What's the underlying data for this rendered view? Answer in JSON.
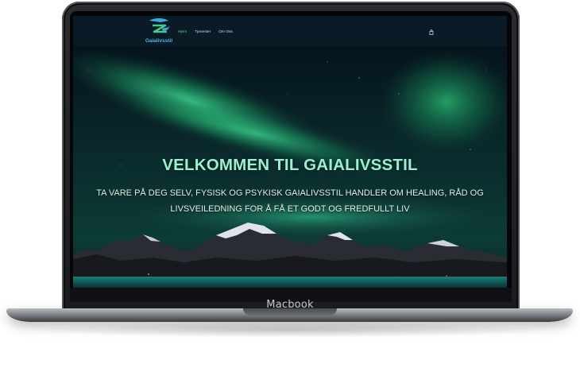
{
  "device": {
    "label": "Macbook"
  },
  "site": {
    "logo_text": "Gaialivsstil",
    "nav": [
      {
        "label": "Hjem",
        "active": true
      },
      {
        "label": "Tjenester",
        "active": false
      },
      {
        "label": "Om Oss",
        "active": false
      }
    ],
    "cart_icon": "shopping-bag-icon",
    "hero": {
      "title": "VELKOMMEN TIL GAIALIVSSTIL",
      "subtitle": "TA VARE PÅ DEG SELV, FYSISK OG PSYKISK GAIALIVSSTIL HANDLER OM HEALING, RÅD OG LIVSVEILEDNING FOR Å FÅ ET GODT OG FREDFULLT LIV"
    }
  },
  "colors": {
    "header_bg": "#0a1a26",
    "accent": "#5fd7a0",
    "title": "#9af0d0",
    "logo": "#4fb3e8"
  }
}
